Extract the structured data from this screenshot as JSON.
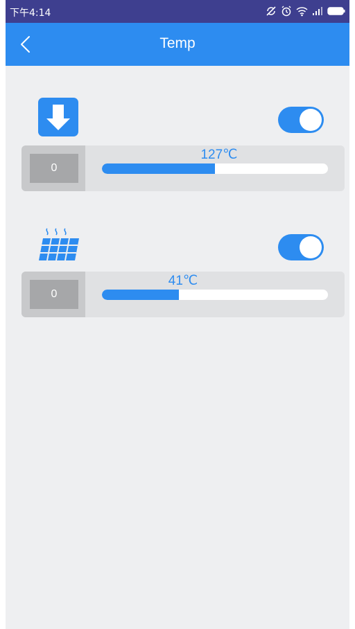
{
  "status_bar": {
    "time": "下午4:14",
    "icons": [
      "sync-off-icon",
      "alarm-icon",
      "wifi-icon",
      "signal-icon",
      "battery-icon"
    ]
  },
  "app_bar": {
    "back_icon": "chevron-left-icon",
    "title": "Temp"
  },
  "colors": {
    "primary": "#2d8cf0",
    "status_bar": "#3e3f8f",
    "background": "#eeeff1",
    "row_bg": "#e0e1e3",
    "value_field_bg": "#a6a7a9"
  },
  "heaters": [
    {
      "icon": "extruder-nozzle-icon",
      "enabled": true,
      "value_field": "0",
      "temperature_label": "127℃",
      "progress_fraction": 0.5
    },
    {
      "icon": "heated-bed-icon",
      "enabled": true,
      "value_field": "0",
      "temperature_label": "41℃",
      "progress_fraction": 0.34
    }
  ]
}
